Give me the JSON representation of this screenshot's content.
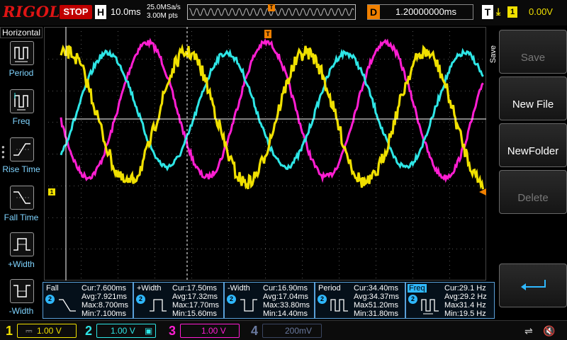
{
  "header": {
    "brand": "RIGOL",
    "run_state": "STOP",
    "timebase_label": "H",
    "timebase": "10.0ms",
    "sample_rate": "25.0MSa/s",
    "memory_depth": "3.00M pts",
    "trigger_marker": "T",
    "delay_label": "D",
    "delay": "1.20000000ms",
    "trigger_label": "T",
    "trigger_edge": "falling",
    "trigger_source": "1",
    "trigger_level": "0.00V"
  },
  "left_menu": {
    "title": "Horizontal",
    "items": [
      {
        "label": "Period"
      },
      {
        "label": "Freq"
      },
      {
        "label": "Rise Time"
      },
      {
        "label": "Fall Time"
      },
      {
        "label": "+Width"
      },
      {
        "label": "-Width"
      }
    ]
  },
  "right_menu": {
    "title": "Save",
    "keys": [
      {
        "label": "Save",
        "enabled": false
      },
      {
        "label": "New File",
        "enabled": true
      },
      {
        "label": "NewFolder",
        "enabled": true
      },
      {
        "label": "Delete",
        "enabled": false
      },
      {
        "label": "",
        "icon": "enter-arrow-icon",
        "enabled": true
      }
    ]
  },
  "waveform": {
    "ch1_marker": "1",
    "trigger_level_marker": "T",
    "colors": {
      "ch1": "#f0e000",
      "ch2": "#2ee6e6",
      "ch3": "#ff1ed2",
      "grid": "#555555",
      "trigger": "#f08000"
    }
  },
  "measurements": [
    {
      "title": "Fall",
      "channel": "2",
      "cur": "Cur:7.600ms",
      "avg": "Avg:7.921ms",
      "max": "Max:8.700ms",
      "min": "Min:7.100ms",
      "selected": false
    },
    {
      "title": "+Width",
      "channel": "2",
      "cur": "Cur:17.50ms",
      "avg": "Avg:17.32ms",
      "max": "Max:17.70ms",
      "min": "Min:15.60ms",
      "selected": false
    },
    {
      "title": "-Width",
      "channel": "2",
      "cur": "Cur:16.90ms",
      "avg": "Avg:17.04ms",
      "max": "Max:33.80ms",
      "min": "Min:14.40ms",
      "selected": false
    },
    {
      "title": "Period",
      "channel": "2",
      "cur": "Cur:34.40ms",
      "avg": "Avg:34.37ms",
      "max": "Max51.20ms",
      "min": "Min:31.80ms",
      "selected": false
    },
    {
      "title": "Freq",
      "channel": "2",
      "cur": "Cur:29.1 Hz",
      "avg": "Avg:29.2 Hz",
      "max": "Max31.4 Hz",
      "min": "Min:19.5 Hz",
      "selected": true
    }
  ],
  "channels": [
    {
      "num": "1",
      "scale": "1.00 V",
      "color": "#f0e000",
      "active": true
    },
    {
      "num": "2",
      "scale": "1.00 V",
      "color": "#2ee6e6",
      "active": true
    },
    {
      "num": "3",
      "scale": "1.00 V",
      "color": "#ff1ed2",
      "active": true
    },
    {
      "num": "4",
      "scale": "200mV",
      "color": "#6a7aa0",
      "active": false
    }
  ]
}
